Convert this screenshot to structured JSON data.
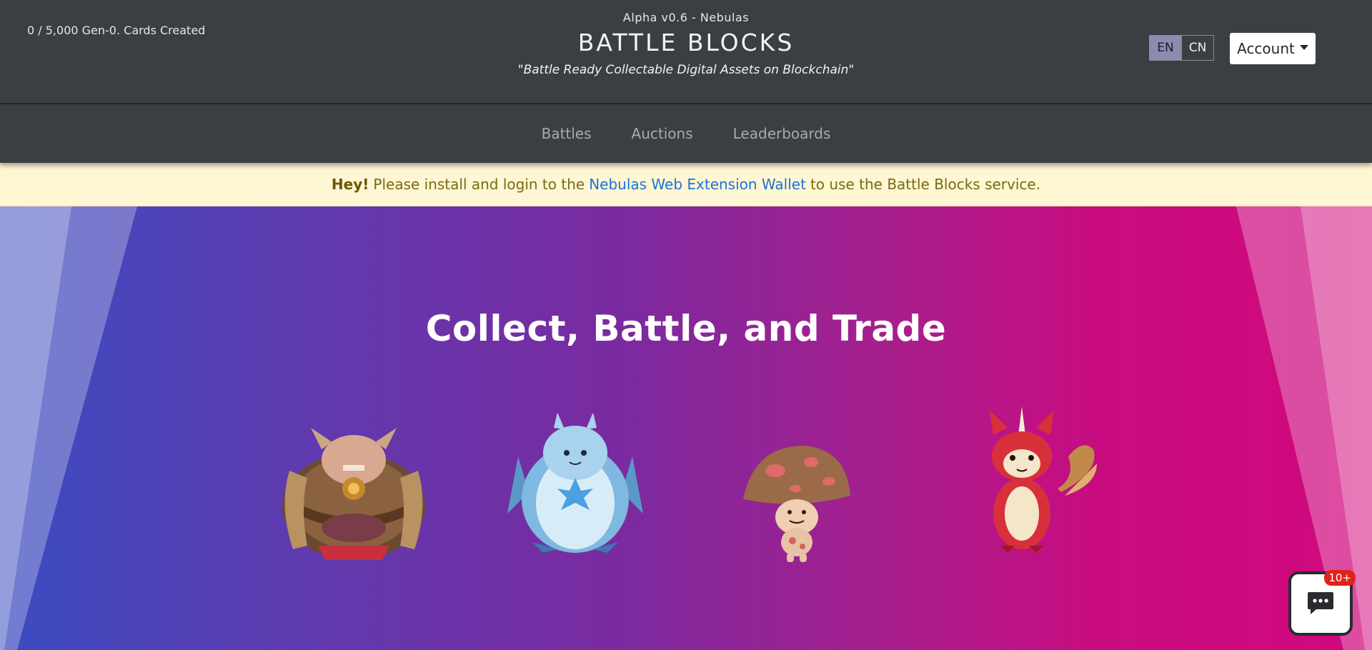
{
  "header": {
    "counter": "0 / 5,000 Gen-0. Cards Created",
    "version": "Alpha v0.6 - Nebulas",
    "title": "BATTLE BLOCKS",
    "tagline": "\"Battle Ready Collectable Digital Assets on Blockchain\""
  },
  "languages": [
    {
      "label": "EN",
      "active": true
    },
    {
      "label": "CN",
      "active": false
    }
  ],
  "account_label": "Account",
  "nav": {
    "items": [
      {
        "label": "Battles"
      },
      {
        "label": "Auctions"
      },
      {
        "label": "Leaderboards"
      }
    ]
  },
  "alert": {
    "prefix": "Hey!",
    "text_before": "Please install and login to the",
    "link": "Nebulas Web Extension Wallet",
    "text_after": "to use the Battle Blocks service."
  },
  "hero": {
    "title": "Collect, Battle, and Trade",
    "creatures": [
      {
        "name": "armored-ogre-icon"
      },
      {
        "name": "ice-yeti-icon"
      },
      {
        "name": "mushroom-icon"
      },
      {
        "name": "fire-fox-icon"
      }
    ]
  },
  "chat": {
    "badge": "10+",
    "icon": "chat-bubble-icon"
  },
  "colors": {
    "topbar": "#3b3e43",
    "alert_bg": "#fff6d3",
    "link": "#1b73d6",
    "hero_start": "#3a4cc0",
    "hero_end": "#d1087d"
  }
}
